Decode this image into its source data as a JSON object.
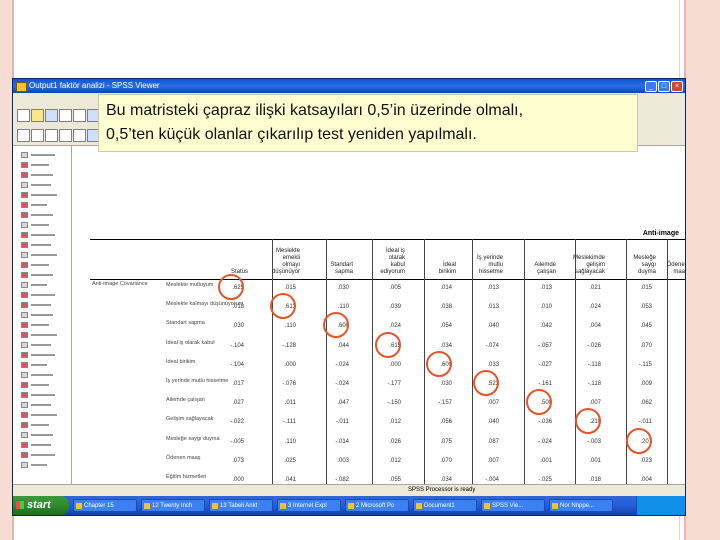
{
  "window": {
    "title": "Output1 faktör analizi - SPSS Viewer"
  },
  "callout": {
    "line1": "Bu matristeki çapraz ilişki katsayıları 0,5’in üzerinde olmalı,",
    "line2": "0,5’ten küçük olanlar çıkarılıp test yeniden yapılmalı."
  },
  "table": {
    "corner_label": "Anti-image",
    "section_label": "Anti-image Covariance",
    "columns": [
      "Statüs",
      "Meslekte\nemekli\nolmayı\ndüşünüyor",
      "Standart\nsapma",
      "İdeal iş\nolarak\nkabul\nediyorum",
      "İdeal\nbirikim",
      "İş yerinde\nmutlu\nhissetme",
      "Ailemde\nçalışan",
      "Meslekimde\ngelişim\nsağlayacak",
      "Mesleğe\nsaygı\nduyma",
      "Ödenen\nmaaş"
    ],
    "rows": [
      {
        "label": "Meslekte mutluyum",
        "values": [
          ".625",
          ".015",
          ".030",
          ".005",
          ".014",
          ".013",
          ".013",
          ".021",
          ".015"
        ]
      },
      {
        "label": "Meslekte kalmayı düşünüyorum",
        "values": [
          ".018",
          ".613",
          ".110",
          ".039",
          ".038",
          ".013",
          ".010",
          ".024",
          ".053"
        ]
      },
      {
        "label": "Standart sapma",
        "values": [
          ".030",
          ".110",
          ".600",
          ".024",
          ".054",
          ".040",
          ".042",
          ".004",
          ".045"
        ]
      },
      {
        "label": "İdeal iş olarak kabul",
        "values": [
          "-.104",
          "-.128",
          ".044",
          ".615",
          ".034",
          "-.074",
          "-.057",
          "-.026",
          ".070"
        ]
      },
      {
        "label": "İdeal birikim",
        "values": [
          "-.104",
          ".000",
          "-.024",
          ".000",
          ".609",
          ".033",
          "-.027",
          "-.118",
          "-.115"
        ]
      },
      {
        "label": "İş yerinde mutlu hissetme",
        "values": [
          ".017",
          "-.076",
          "-.024",
          "-.177",
          ".030",
          ".523",
          "-.161",
          "-.118",
          ".009"
        ]
      },
      {
        "label": "Ailemde çalışan",
        "values": [
          ".027",
          ".011",
          ".047",
          "-.150",
          "-.157",
          ".007",
          ".500",
          ".007",
          ".062"
        ]
      },
      {
        "label": "Gelişim sağlayacak",
        "values": [
          "-.022",
          "-.111",
          "-.011",
          ".012",
          ".056",
          ".040",
          "-.036",
          ".210",
          "-.011"
        ]
      },
      {
        "label": "Mesleğe saygı duyma",
        "values": [
          "-.005",
          ".110",
          "-.014",
          ".026",
          ".075",
          ".087",
          "-.024",
          "-.003",
          ".207"
        ]
      },
      {
        "label": "Ödenen maaş",
        "values": [
          ".073",
          ".025",
          ".003",
          ".012",
          ".070",
          ".007",
          ".001",
          ".001",
          ".023"
        ]
      },
      {
        "label": "Eğitim hizmetleri",
        "values": [
          ".000",
          ".041",
          "-.082",
          ".055",
          ".034",
          "-.004",
          "-.025",
          ".018",
          ".004"
        ]
      }
    ]
  },
  "statusbar": {
    "text": "SPSS Processor is ready"
  },
  "taskbar": {
    "start": "start",
    "tasks": [
      "Chapter 15",
      "12 Twenty Inch",
      "13 Tabeli Ankt",
      "3 Internet Expl",
      "2 Microsoft Po",
      "Document1",
      "SPSS Vie...",
      "Nor Nnppe..."
    ]
  },
  "colors": {
    "circle": "#e8542a",
    "callout_bg": "#fefed0",
    "frame": "#f6dcd2"
  }
}
